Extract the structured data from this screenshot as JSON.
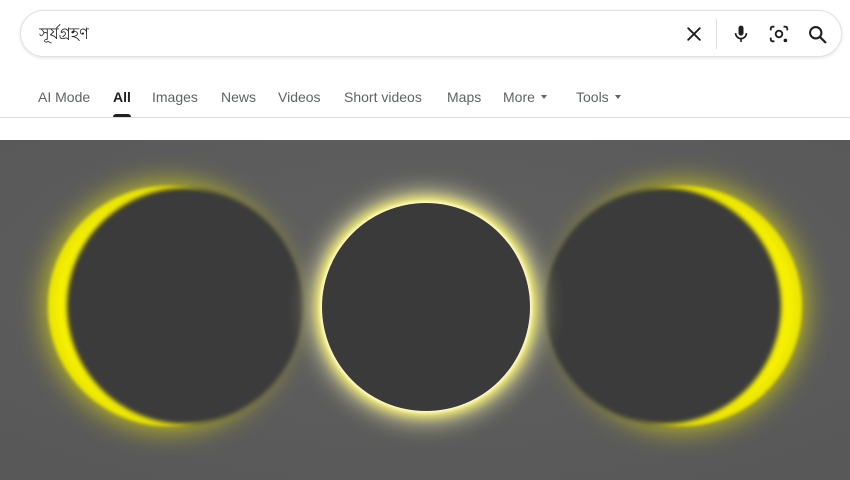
{
  "search": {
    "query": "সূর্যগ্রহণ"
  },
  "icons": {
    "clear": "close-icon",
    "voice": "microphone-icon",
    "lens": "camera-lens-icon",
    "search": "search-icon"
  },
  "tabs": [
    {
      "label": "AI Mode",
      "active": false
    },
    {
      "label": "All",
      "active": true
    },
    {
      "label": "Images",
      "active": false
    },
    {
      "label": "News",
      "active": false
    },
    {
      "label": "Videos",
      "active": false
    },
    {
      "label": "Short videos",
      "active": false
    },
    {
      "label": "Maps",
      "active": false
    },
    {
      "label": "More",
      "active": false,
      "dropdown": true
    },
    {
      "label": "Tools",
      "active": false,
      "dropdown": true
    }
  ],
  "colors": {
    "accent_text": "#202124",
    "muted_text": "#5f6368",
    "icon": "#1f1f1f",
    "eclipse_corona": "#f5f200",
    "eclipse_disk": "#3c3c3c",
    "hero_background": "#5a5a5a"
  }
}
